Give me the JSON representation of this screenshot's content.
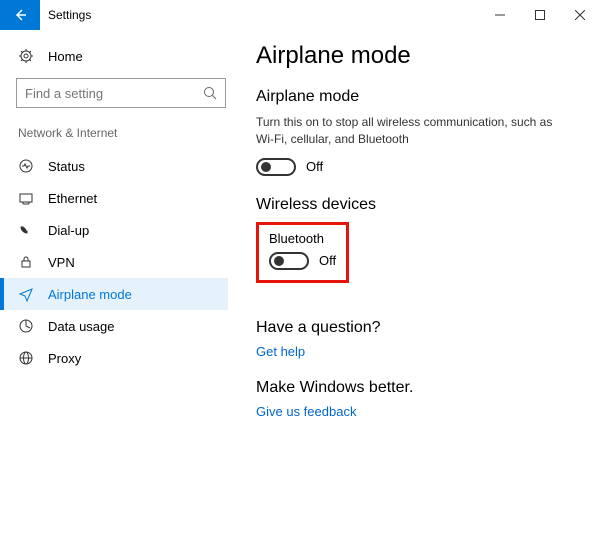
{
  "window": {
    "title": "Settings"
  },
  "sidebar": {
    "home": "Home",
    "search_placeholder": "Find a setting",
    "category": "Network & Internet",
    "items": [
      {
        "label": "Status"
      },
      {
        "label": "Ethernet"
      },
      {
        "label": "Dial-up"
      },
      {
        "label": "VPN"
      },
      {
        "label": "Airplane mode"
      },
      {
        "label": "Data usage"
      },
      {
        "label": "Proxy"
      }
    ]
  },
  "main": {
    "page_title": "Airplane mode",
    "airplane": {
      "heading": "Airplane mode",
      "description": "Turn this on to stop all wireless communication, such as Wi-Fi, cellular, and Bluetooth",
      "state": "Off"
    },
    "wireless": {
      "heading": "Wireless devices",
      "bluetooth_label": "Bluetooth",
      "bluetooth_state": "Off"
    },
    "question": {
      "heading": "Have a question?",
      "link": "Get help"
    },
    "feedback": {
      "heading": "Make Windows better.",
      "link": "Give us feedback"
    }
  }
}
